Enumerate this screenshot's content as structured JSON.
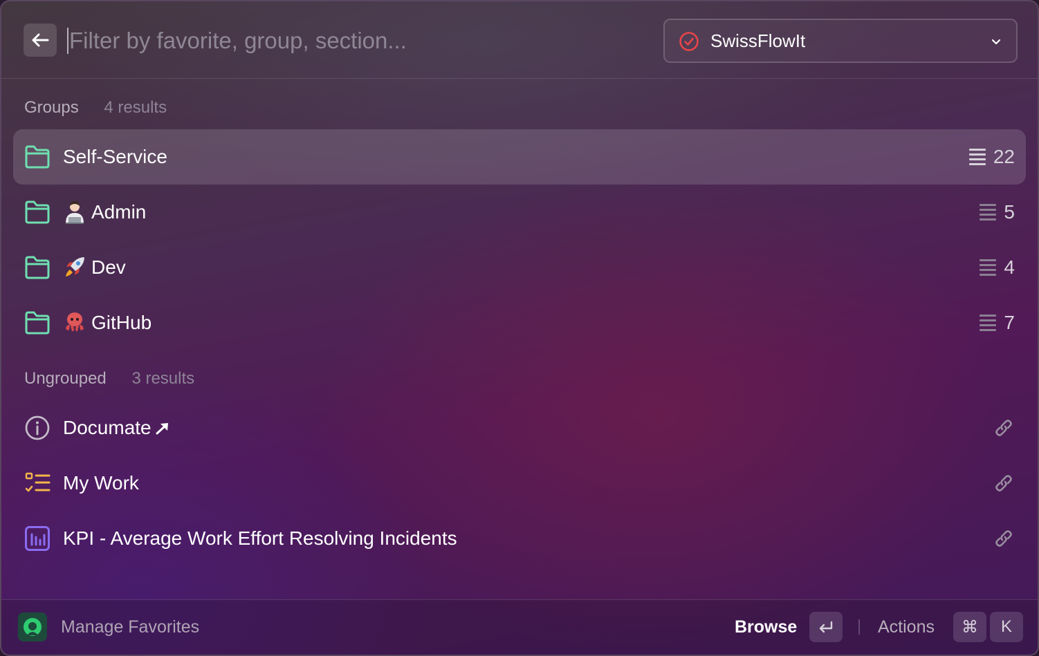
{
  "header": {
    "back_button": "back-arrow-icon",
    "search_placeholder": "Filter by favorite, group, section...",
    "search_value": "",
    "org_selector": {
      "icon": "check-circle-icon",
      "name": "SwissFlowIt",
      "status_color": "#e8454a"
    }
  },
  "sections": [
    {
      "title": "Groups",
      "count_text": "4 results",
      "items": [
        {
          "icon": "folder-icon",
          "emoji": "",
          "label": "Self-Service",
          "count": "22",
          "selected": true
        },
        {
          "icon": "folder-icon",
          "emoji": "🧑🏻‍💻",
          "label": "Admin",
          "count": "5",
          "selected": false
        },
        {
          "icon": "folder-icon",
          "emoji": "🚀",
          "label": "Dev",
          "count": "4",
          "selected": false
        },
        {
          "icon": "folder-icon",
          "emoji": "🐙",
          "label": "GitHub",
          "count": "7",
          "selected": false
        }
      ]
    },
    {
      "title": "Ungrouped",
      "count_text": "3 results",
      "items": [
        {
          "icon": "info-circle-icon",
          "label": "Documate",
          "suffix_icon": "arrow-up-right-icon",
          "trailing_icon": "link-icon"
        },
        {
          "icon": "checklist-icon",
          "label": "My Work",
          "trailing_icon": "link-icon"
        },
        {
          "icon": "bar-chart-icon",
          "label": "KPI - Average Work Effort Resolving Incidents",
          "trailing_icon": "link-icon"
        }
      ]
    }
  ],
  "footer": {
    "manage_label": "Manage Favorites",
    "browse_label": "Browse",
    "browse_key": "↵",
    "actions_label": "Actions",
    "actions_keys": [
      "⌘",
      "K"
    ]
  },
  "colors": {
    "folder": "#6ee0b0",
    "info": "#c4bcc8",
    "checklist": "#f2b64a",
    "chart": "#8a6cf0",
    "brand": "#2ecc71"
  }
}
